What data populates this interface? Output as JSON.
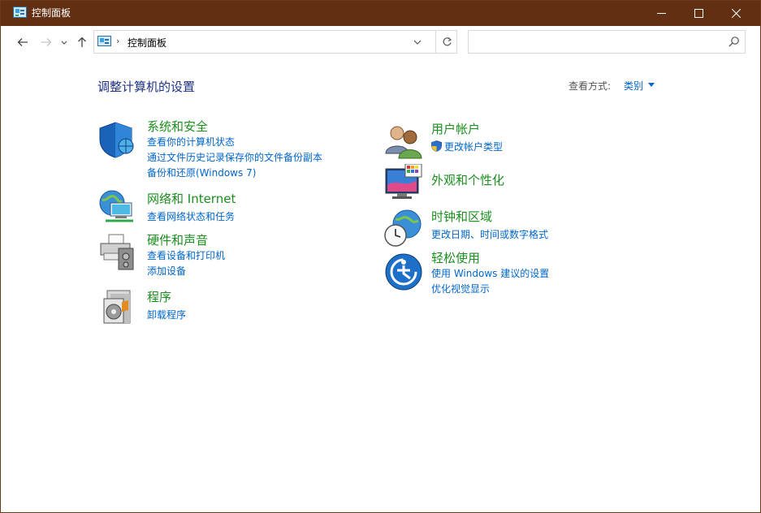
{
  "window": {
    "title": "控制面板",
    "titlebar_color": "#632f12"
  },
  "address_bar": {
    "separator": "›",
    "path_label": "控制面板"
  },
  "search": {
    "placeholder": ""
  },
  "main": {
    "heading": "调整计算机的设置",
    "view_by_label": "查看方式:",
    "view_by_value": "类别"
  },
  "categories": [
    {
      "title": "系统和安全",
      "icon": "security-shield-icon",
      "links": [
        "查看你的计算机状态",
        "通过文件历史记录保存你的文件备份副本",
        "备份和还原(Windows 7)"
      ]
    },
    {
      "title": "网络和 Internet",
      "icon": "network-globe-icon",
      "links": [
        "查看网络状态和任务"
      ]
    },
    {
      "title": "硬件和声音",
      "icon": "printer-speaker-icon",
      "links": [
        "查看设备和打印机",
        "添加设备"
      ]
    },
    {
      "title": "程序",
      "icon": "programs-icon",
      "links": [
        "卸载程序"
      ]
    },
    {
      "title": "用户帐户",
      "icon": "users-icon",
      "links": [
        "更改帐户类型"
      ]
    },
    {
      "title": "外观和个性化",
      "icon": "monitor-palette-icon",
      "links": []
    },
    {
      "title": "时钟和区域",
      "icon": "clock-globe-icon",
      "links": [
        "更改日期、时间或数字格式"
      ]
    },
    {
      "title": "轻松使用",
      "icon": "ease-of-access-icon",
      "links": [
        "使用 Windows 建议的设置",
        "优化视觉显示"
      ]
    }
  ],
  "colors": {
    "heading": "#1e3287",
    "category_title": "#1b8f1e",
    "link": "#0066cc"
  }
}
